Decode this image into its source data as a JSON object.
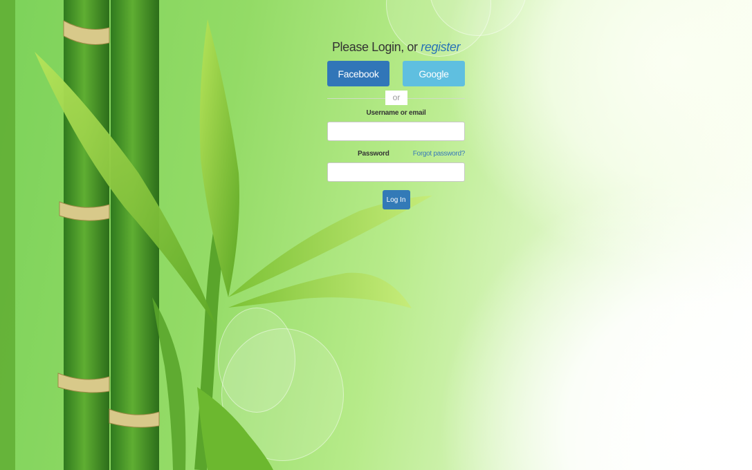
{
  "login": {
    "heading_prefix": "Please Login, or ",
    "register_link": "register",
    "oauth": {
      "facebook_label": "Facebook",
      "google_label": "Google"
    },
    "divider_text": "or",
    "username_label": "Username or email",
    "username_value": "",
    "password_label": "Password",
    "password_value": "",
    "forgot_link": "Forgot password?",
    "submit_label": "Log In"
  },
  "colors": {
    "facebook": "#3176b8",
    "google": "#5fbfe0",
    "primary": "#337ab7",
    "link": "#2a74b6"
  },
  "icons": {
    "background": "bamboo-illustration"
  }
}
